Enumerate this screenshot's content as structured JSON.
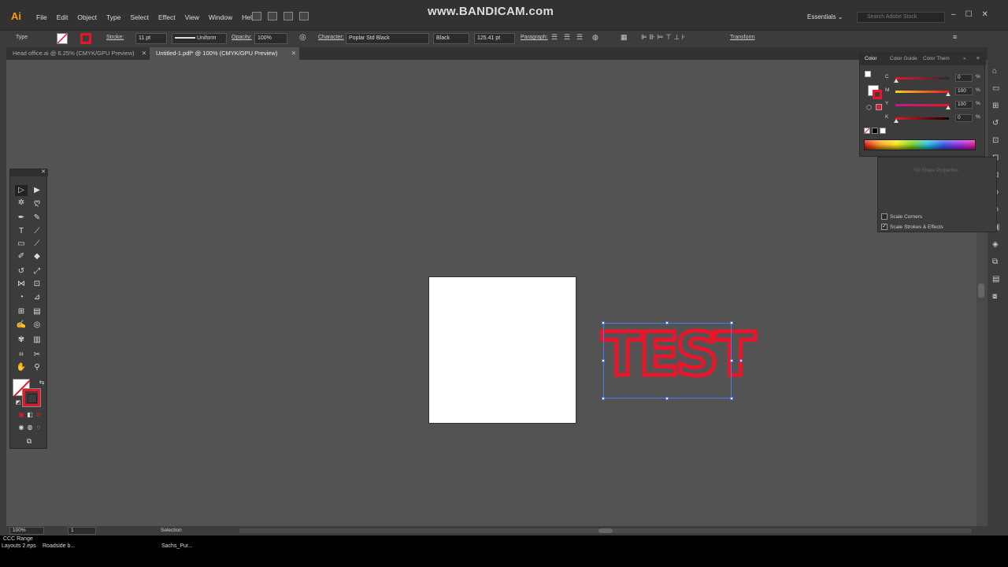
{
  "app": {
    "logo": "Ai",
    "menu": [
      "File",
      "Edit",
      "Object",
      "Type",
      "Select",
      "Effect",
      "View",
      "Window",
      "Help"
    ],
    "watermark": "www.BANDICAM.com",
    "workspace": "Essentials",
    "search_placeholder": "Search Adobe Stock",
    "window_controls": [
      "–",
      "☐",
      "✕"
    ]
  },
  "control_bar": {
    "type_label": "Type",
    "stroke_label": "Stroke:",
    "stroke_weight": "11 pt",
    "stroke_profile": "Uniform",
    "opacity_label": "Opacity:",
    "opacity_value": "100%",
    "character_label": "Character:",
    "font_family": "Poplar Std Black",
    "font_style": "Black",
    "font_size": "125.41 pt",
    "paragraph_label": "Paragraph:",
    "transform_label": "Transform",
    "fill_color": "#ffffff",
    "stroke_color": "#e8162a"
  },
  "tabs": [
    {
      "label": "Head office.ai @ 6.25% (CMYK/GPU Preview)",
      "close": "✕"
    },
    {
      "label": "Untitled-1.pdf* @ 100% (CMYK/GPU Preview)",
      "close": "✕"
    }
  ],
  "canvas": {
    "text": "TEST",
    "text_stroke_color": "#e8162a",
    "artboard_color": "#ffffff"
  },
  "color_panel": {
    "tabs": [
      "Color",
      "Color Guide",
      "Color Them"
    ],
    "channels": [
      {
        "label": "C",
        "value": "0",
        "unit": "%",
        "level": 0
      },
      {
        "label": "M",
        "value": "100",
        "unit": "%",
        "level": 100
      },
      {
        "label": "Y",
        "value": "100",
        "unit": "%",
        "level": 100
      },
      {
        "label": "K",
        "value": "0",
        "unit": "%",
        "level": 0
      }
    ]
  },
  "transform_panel": {
    "no_shape": "No Shape Properties",
    "options": [
      {
        "label": "Scale Corners",
        "checked": false
      },
      {
        "label": "Scale Strokes & Effects",
        "checked": true
      }
    ]
  },
  "status_bar": {
    "zoom": "100%",
    "artboard_num": "1",
    "tool": "Selection"
  },
  "desktop": {
    "labels": [
      "CCC Range",
      "Layouts 2.eps",
      "Roadside b...",
      "Sachs_Pur..."
    ]
  }
}
